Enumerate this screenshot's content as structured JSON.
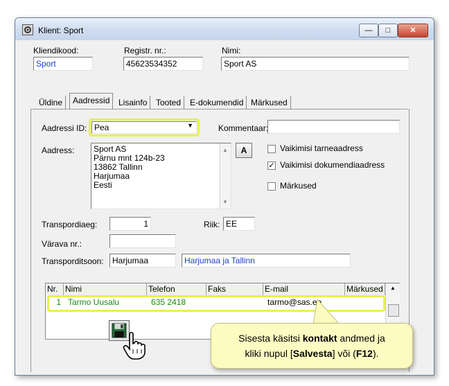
{
  "window": {
    "title": "Klient: Sport",
    "controls": {
      "minimize": "—",
      "maximize": "□",
      "close": "✕"
    }
  },
  "header": {
    "client_code_label": "Kliendikood:",
    "client_code_value": "Sport",
    "reg_no_label": "Registr. nr.:",
    "reg_no_value": "45623534352",
    "name_label": "Nimi:",
    "name_value": "Sport AS"
  },
  "tabs": [
    {
      "label": "Üldine"
    },
    {
      "label": "Aadressid"
    },
    {
      "label": "Lisainfo"
    },
    {
      "label": "Tooted"
    },
    {
      "label": "E-dokumendid"
    },
    {
      "label": "Märkused"
    }
  ],
  "address": {
    "id_label": "Aadressi ID:",
    "id_value": "Pea",
    "comment_label": "Kommentaar:",
    "comment_value": "",
    "address_label": "Aadress:",
    "address_lines": [
      "Sport AS",
      "Pärnu mnt 124b-23",
      "13862 Tallinn",
      "Harjumaa",
      "Eesti"
    ],
    "font_button": "A",
    "checkbox_default_delivery": {
      "label": "Vaikimisi tarneaadress",
      "checked": false
    },
    "checkbox_default_document": {
      "label": "Vaikimisi dokumendiaadress",
      "checked": true,
      "mark": "✓"
    },
    "checkbox_remarks": {
      "label": "Märkused",
      "checked": false
    },
    "transport_delay_label": "Transpordiaeg:",
    "transport_delay_value": "1",
    "country_label": "Riik:",
    "country_value": "EE",
    "gate_label": "Värava nr.:",
    "gate_value": "",
    "transport_zone_label": "Transporditsoon:",
    "transport_zone_code": "Harjumaa",
    "transport_zone_name": "Harjumaa ja Tallinn"
  },
  "contacts_grid": {
    "columns": [
      "Nr.",
      "Nimi",
      "Telefon",
      "Faks",
      "E-mail",
      "Märkused"
    ],
    "rows": [
      {
        "nr": "1",
        "name": "Tarmo Uusalu",
        "phone": "635 2418",
        "fax": "",
        "email": "tarmo@sas.ee",
        "notes": ""
      }
    ],
    "scroll_up": "▲"
  },
  "callout": {
    "line1_pre": "Sisesta käsitsi ",
    "line1_bold": "kontakt",
    "line1_post": " andmed ja",
    "line2_pre": "kliki nupul [",
    "line2_bold": "Salvesta",
    "line2_mid": "] või (",
    "line2_bold2": "F12",
    "line2_post": ")."
  },
  "colors": {
    "highlight": "#e6f24c",
    "grid_text": "#1b8a1b",
    "link_blue": "#1f3fcf",
    "callout_bg": "#fcfbc1"
  }
}
